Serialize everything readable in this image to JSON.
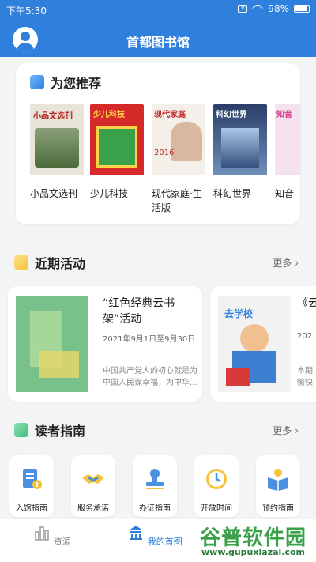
{
  "status_bar": {
    "time": "下午5:30",
    "battery": "98%"
  },
  "header": {
    "title": "首都图书馆"
  },
  "recommend": {
    "heading": "为您推荐",
    "books": [
      {
        "title": "小品文选刊",
        "cover_text": "小品文选刊"
      },
      {
        "title": "少儿科技",
        "cover_text": "少儿科技"
      },
      {
        "title": "现代家庭·生活版",
        "cover_text": "现代家庭",
        "cover_text2": "2016"
      },
      {
        "title": "科幻世界",
        "cover_text": "科幻世界"
      },
      {
        "title": "知音",
        "cover_text": "知音"
      }
    ]
  },
  "activities": {
    "heading": "近期活动",
    "more": "更多",
    "items": [
      {
        "title": "“红色经典云书架”活动",
        "date": "2021年9月1日至9月30日",
        "desc": "中国共产党人的初心就是为中国人民谋幸福，为中华..."
      },
      {
        "title": "《云",
        "date": "202",
        "desc": "本期愉快",
        "poster_text": "去学校"
      }
    ]
  },
  "guide": {
    "heading": "读者指南",
    "more": "更多",
    "tiles": [
      {
        "label": "入馆指南",
        "icon": "guide-doc-icon"
      },
      {
        "label": "服务承诺",
        "icon": "handshake-icon"
      },
      {
        "label": "办证指南",
        "icon": "stamp-icon"
      },
      {
        "label": "开放时间",
        "icon": "clock-icon"
      },
      {
        "label": "预约指南",
        "icon": "book-icon"
      }
    ]
  },
  "bottom_nav": {
    "items": [
      {
        "label": "资源",
        "icon": "bar-chart-icon"
      },
      {
        "label": "我的首图",
        "icon": "temple-icon"
      }
    ]
  },
  "watermark": {
    "text": "谷普软件园",
    "url": "www.gupuxlazal.com"
  },
  "colors": {
    "primary": "#2f7fdc",
    "activity_accent": "#f5c33a",
    "guide_accent": "#3fbf7f"
  }
}
